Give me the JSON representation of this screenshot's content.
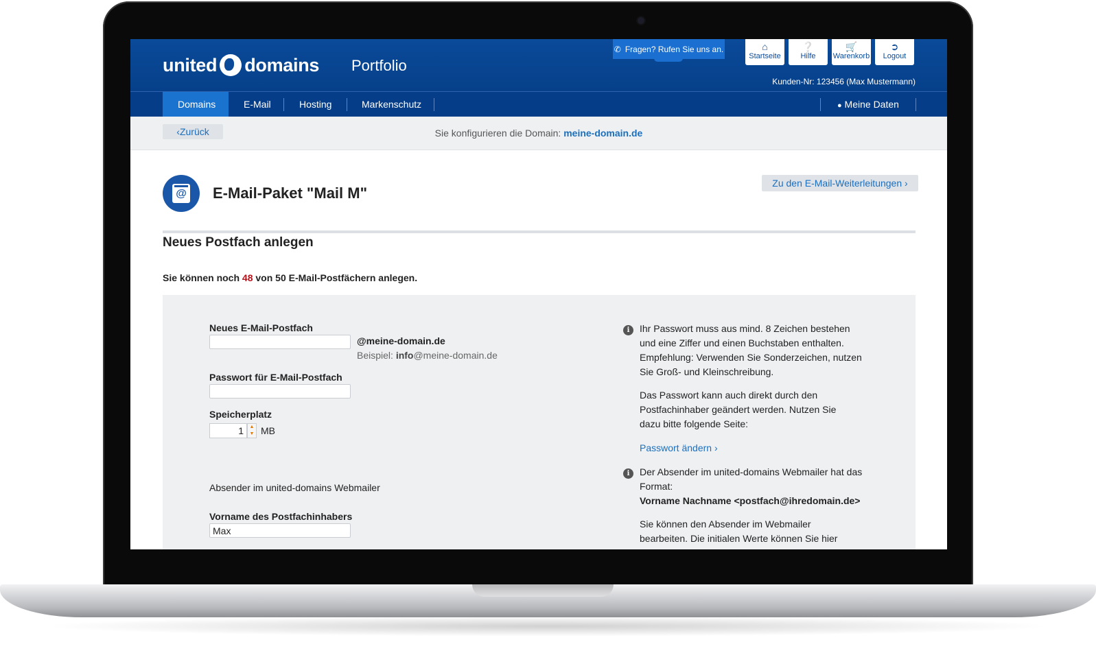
{
  "app": {
    "logo_left": "united",
    "logo_right": "domains",
    "product": "Portfolio"
  },
  "toolbar": {
    "phone_label": "Fragen? Rufen Sie uns an.",
    "buttons": [
      {
        "label": "Startseite",
        "icon": "home-icon"
      },
      {
        "label": "Hilfe",
        "icon": "help-icon"
      },
      {
        "label": "Warenkorb",
        "icon": "cart-icon"
      },
      {
        "label": "Logout",
        "icon": "logout-icon"
      }
    ],
    "customer": "Kunden-Nr: 123456 (Max Mustermann)"
  },
  "nav": {
    "items": [
      {
        "label": "Domains",
        "active": true
      },
      {
        "label": "E-Mail"
      },
      {
        "label": "Hosting"
      },
      {
        "label": "Markenschutz"
      }
    ],
    "account": "Meine Daten"
  },
  "subbar": {
    "back": "Zurück",
    "config_prefix": "Sie konfigurieren die Domain:",
    "domain": "meine-domain.de"
  },
  "package": {
    "title": "E-Mail-Paket \"Mail M\"",
    "forward_link": "Zu den E-Mail-Weiterleitungen"
  },
  "section": {
    "title": "Neues Postfach anlegen",
    "quota_prefix": "Sie können noch",
    "quota_remaining": "48",
    "quota_suffix": "von 50 E-Mail-Postfächern anlegen."
  },
  "form": {
    "mailbox_label": "Neues E-Mail-Postfach",
    "mailbox_value": "",
    "domain_suffix": "@meine-domain.de",
    "example_prefix": "Beispiel:",
    "example_bold": "info",
    "example_rest": "@meine-domain.de",
    "password_label": "Passwort für E-Mail-Postfach",
    "password_value": "",
    "storage_label": "Speicherplatz",
    "storage_value": "1",
    "storage_unit": "MB",
    "sender_heading": "Absender im united-domains Webmailer",
    "firstname_label": "Vorname des Postfachinhabers",
    "firstname_value": "Max"
  },
  "hints": {
    "password_rules": "Ihr Passwort muss aus mind. 8 Zeichen bestehen und eine Ziffer und einen Buchstaben enthalten. Empfehlung: Verwenden Sie Sonderzeichen, nutzen Sie Groß- und Kleinschreibung.",
    "password_change": "Das Passwort kann auch direkt durch den Postfachinhaber geändert werden. Nutzen Sie dazu bitte folgende Seite:",
    "password_link": "Passwort ändern",
    "sender_format_intro": "Der Absender im united-domains Webmailer hat das Format:",
    "sender_format": "Vorname Nachname <postfach@ihredomain.de>",
    "sender_edit": "Sie können den Absender im Webmailer bearbeiten. Die initialen Werte können Sie hier festlegen."
  }
}
